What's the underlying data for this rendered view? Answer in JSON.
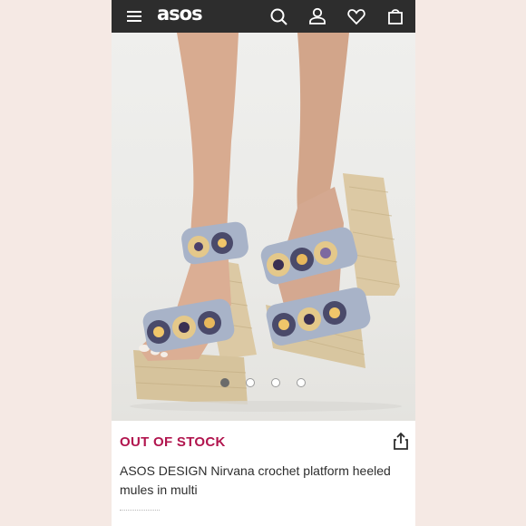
{
  "header": {
    "logo": "asos",
    "icons": [
      "menu-icon",
      "search-icon",
      "account-icon",
      "heart-icon",
      "bag-icon"
    ]
  },
  "gallery": {
    "image_subject": "crochet platform heeled mules",
    "slide_count": 4,
    "active_slide": 1
  },
  "product": {
    "stock_status": "OUT OF STOCK",
    "title": "ASOS DESIGN Nirvana crochet platform heeled mules in multi"
  },
  "colors": {
    "header_bg": "#2d2d2d",
    "stock_red": "#b1154e",
    "page_bg": "#f5e9e4"
  }
}
